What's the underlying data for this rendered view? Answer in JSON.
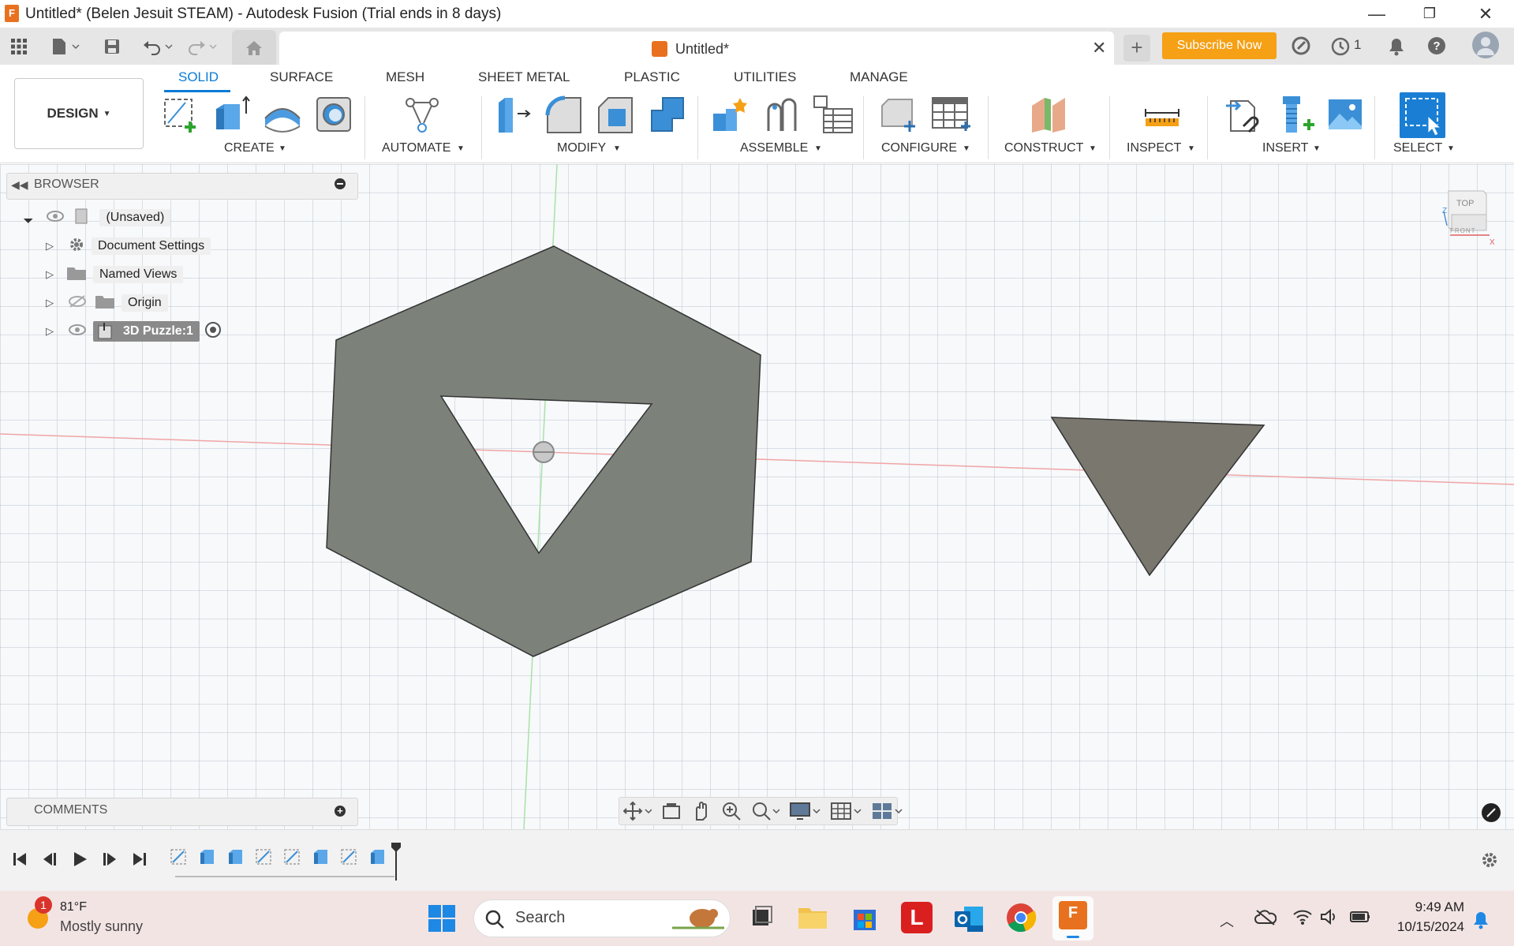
{
  "window": {
    "title": "Untitled* (Belen Jesuit STEAM) - Autodesk Fusion (Trial ends in 8 days)",
    "minimize": "—",
    "restore": "❐",
    "close": "✕"
  },
  "tabstrip": {
    "doc_title": "Untitled*",
    "subscribe": "Subscribe Now",
    "jobs": "1",
    "new_tab": "+",
    "close_tab": "✕"
  },
  "ribbon": {
    "workspace": "DESIGN",
    "tabs": [
      "SOLID",
      "SURFACE",
      "MESH",
      "SHEET METAL",
      "PLASTIC",
      "UTILITIES",
      "MANAGE"
    ],
    "groups": [
      "CREATE",
      "AUTOMATE",
      "MODIFY",
      "ASSEMBLE",
      "CONFIGURE",
      "CONSTRUCT",
      "INSPECT",
      "INSERT",
      "SELECT"
    ]
  },
  "browser": {
    "title": "BROWSER",
    "root": "(Unsaved)",
    "items": [
      "Document Settings",
      "Named Views",
      "Origin",
      "3D Puzzle:1"
    ]
  },
  "viewcube": {
    "top": "TOP",
    "front": "FRONT"
  },
  "comments": {
    "title": "COMMENTS"
  },
  "taskbar": {
    "badge": "1",
    "temp": "81°F",
    "weather": "Mostly sunny",
    "search": "Search",
    "time": "9:49 AM",
    "date": "10/15/2024"
  },
  "colors": {
    "accent": "#0a7bd6",
    "brand_orange": "#e8711f",
    "subscribe": "#f5a015",
    "body_gray": "#7c817a",
    "triangle_gray": "#7a776e"
  }
}
